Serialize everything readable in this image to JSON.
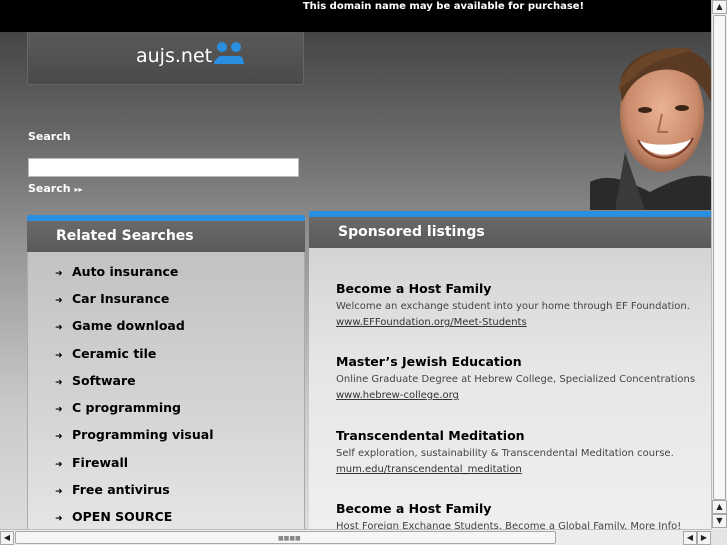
{
  "banner": {
    "text": "This domain name may be available for purchase!"
  },
  "logo": {
    "text": "aujs.net",
    "icon": "two-people-chat-icon",
    "icon_color": "#2a8fe0"
  },
  "search": {
    "label": "Search",
    "value": "",
    "button_label": "Search"
  },
  "related": {
    "title": "Related Searches",
    "items": [
      "Auto insurance",
      "Car Insurance",
      "Game download",
      "Ceramic tile",
      "Software",
      "C programming",
      "Programming visual",
      "Firewall",
      "Free antivirus",
      "OPEN SOURCE"
    ]
  },
  "sponsored": {
    "title": "Sponsored listings",
    "listings": [
      {
        "title": "Become a Host Family",
        "description": "Welcome an exchange student into your home through EF Foundation.",
        "url": "www.EFFoundation.org/Meet-Students"
      },
      {
        "title": "Master’s Jewish Education",
        "description": "Online Graduate Degree at Hebrew College, Specialized Concentrations",
        "url": "www.hebrew-college.org"
      },
      {
        "title": "Transcendental Meditation",
        "description": "Self exploration, sustainability & Transcendental Meditation course.",
        "url": "mum.edu/transcendental_meditation"
      },
      {
        "title": "Become a Host Family",
        "description": "Host Foreign Exchange Students. Become a Global Family. More Info!",
        "url": ""
      }
    ]
  },
  "colors": {
    "accent": "#2a8fe0",
    "header_gray": "#616161"
  }
}
